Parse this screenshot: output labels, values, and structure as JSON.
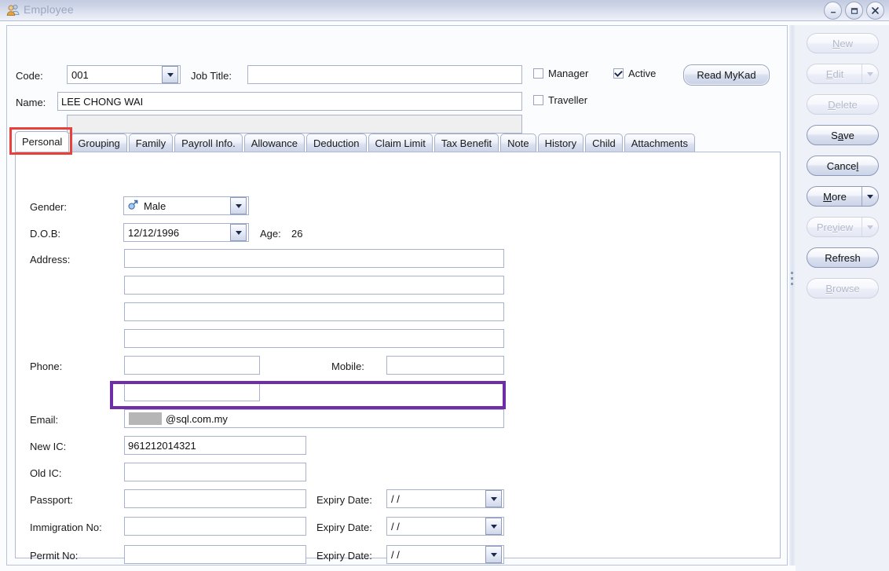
{
  "window": {
    "title": "Employee",
    "icon": "employee-people-icon",
    "controls": [
      {
        "name": "minimize",
        "glyph": "–"
      },
      {
        "name": "maximize",
        "glyph": "❐"
      },
      {
        "name": "close",
        "glyph": "✕"
      }
    ]
  },
  "header": {
    "code_label": "Code:",
    "code_value": "001",
    "job_title_label": "Job Title:",
    "job_title_value": "",
    "name_label": "Name:",
    "name_value": "LEE CHONG WAI",
    "extra_value": "",
    "manager_label": "Manager",
    "manager_checked": false,
    "active_label": "Active",
    "active_checked": true,
    "traveller_label": "Traveller",
    "traveller_checked": false,
    "read_mykad_label": "Read MyKad"
  },
  "tabs": [
    {
      "label": "Personal",
      "active": true
    },
    {
      "label": "Grouping",
      "active": false
    },
    {
      "label": "Family",
      "active": false
    },
    {
      "label": "Payroll Info.",
      "active": false
    },
    {
      "label": "Allowance",
      "active": false
    },
    {
      "label": "Deduction",
      "active": false
    },
    {
      "label": "Claim Limit",
      "active": false
    },
    {
      "label": "Tax Benefit",
      "active": false
    },
    {
      "label": "Note",
      "active": false
    },
    {
      "label": "History",
      "active": false
    },
    {
      "label": "Child",
      "active": false
    },
    {
      "label": "Attachments",
      "active": false
    }
  ],
  "personal": {
    "gender_label": "Gender:",
    "gender_value": "Male",
    "gender_icon": "male-symbol-icon",
    "dob_label": "D.O.B:",
    "dob_value": "12/12/1996",
    "age_label": "Age:",
    "age_value": "26",
    "address_label": "Address:",
    "address_line1": "",
    "address_line2": "",
    "address_line3": "",
    "address_line4": "",
    "phone_label": "Phone:",
    "phone_value": "",
    "phone2_value": "",
    "mobile_label": "Mobile:",
    "mobile_value": "",
    "email_label": "Email:",
    "email_value": "@sql.com.my",
    "email_redacted": true,
    "new_ic_label": "New IC:",
    "new_ic_value": "961212014321",
    "old_ic_label": "Old IC:",
    "old_ic_value": "",
    "passport_label": "Passport:",
    "passport_value": "",
    "passport_expiry_label": "Expiry Date:",
    "passport_expiry_value": "/  /",
    "immigration_label": "Immigration No:",
    "immigration_value": "",
    "immigration_expiry_label": "Expiry Date:",
    "immigration_expiry_value": "/  /",
    "permit_label": "Permit No:",
    "permit_value": "",
    "permit_expiry_label": "Expiry Date:",
    "permit_expiry_value": "/  /"
  },
  "actions": [
    {
      "name": "new",
      "label": "New",
      "mnemonic": "N",
      "enabled": false,
      "split": false
    },
    {
      "name": "edit",
      "label": "Edit",
      "mnemonic": "E",
      "enabled": false,
      "split": true
    },
    {
      "name": "delete",
      "label": "Delete",
      "mnemonic": "D",
      "enabled": false,
      "split": false
    },
    {
      "name": "save",
      "label": "Save",
      "mnemonic": "a",
      "enabled": true,
      "split": false
    },
    {
      "name": "cancel",
      "label": "Cancel",
      "mnemonic": "l",
      "enabled": true,
      "split": false
    },
    {
      "name": "more",
      "label": "More",
      "mnemonic": "M",
      "enabled": true,
      "split": true
    },
    {
      "name": "preview",
      "label": "Preview",
      "mnemonic": "v",
      "enabled": false,
      "split": true
    },
    {
      "name": "refresh",
      "label": "Refresh",
      "mnemonic": "",
      "enabled": true,
      "split": false
    },
    {
      "name": "browse",
      "label": "Browse",
      "mnemonic": "B",
      "enabled": false,
      "split": false
    }
  ],
  "annotations": {
    "personal_tab_highlight_color": "#e8413c",
    "email_field_highlight_color": "#6f2da8"
  }
}
